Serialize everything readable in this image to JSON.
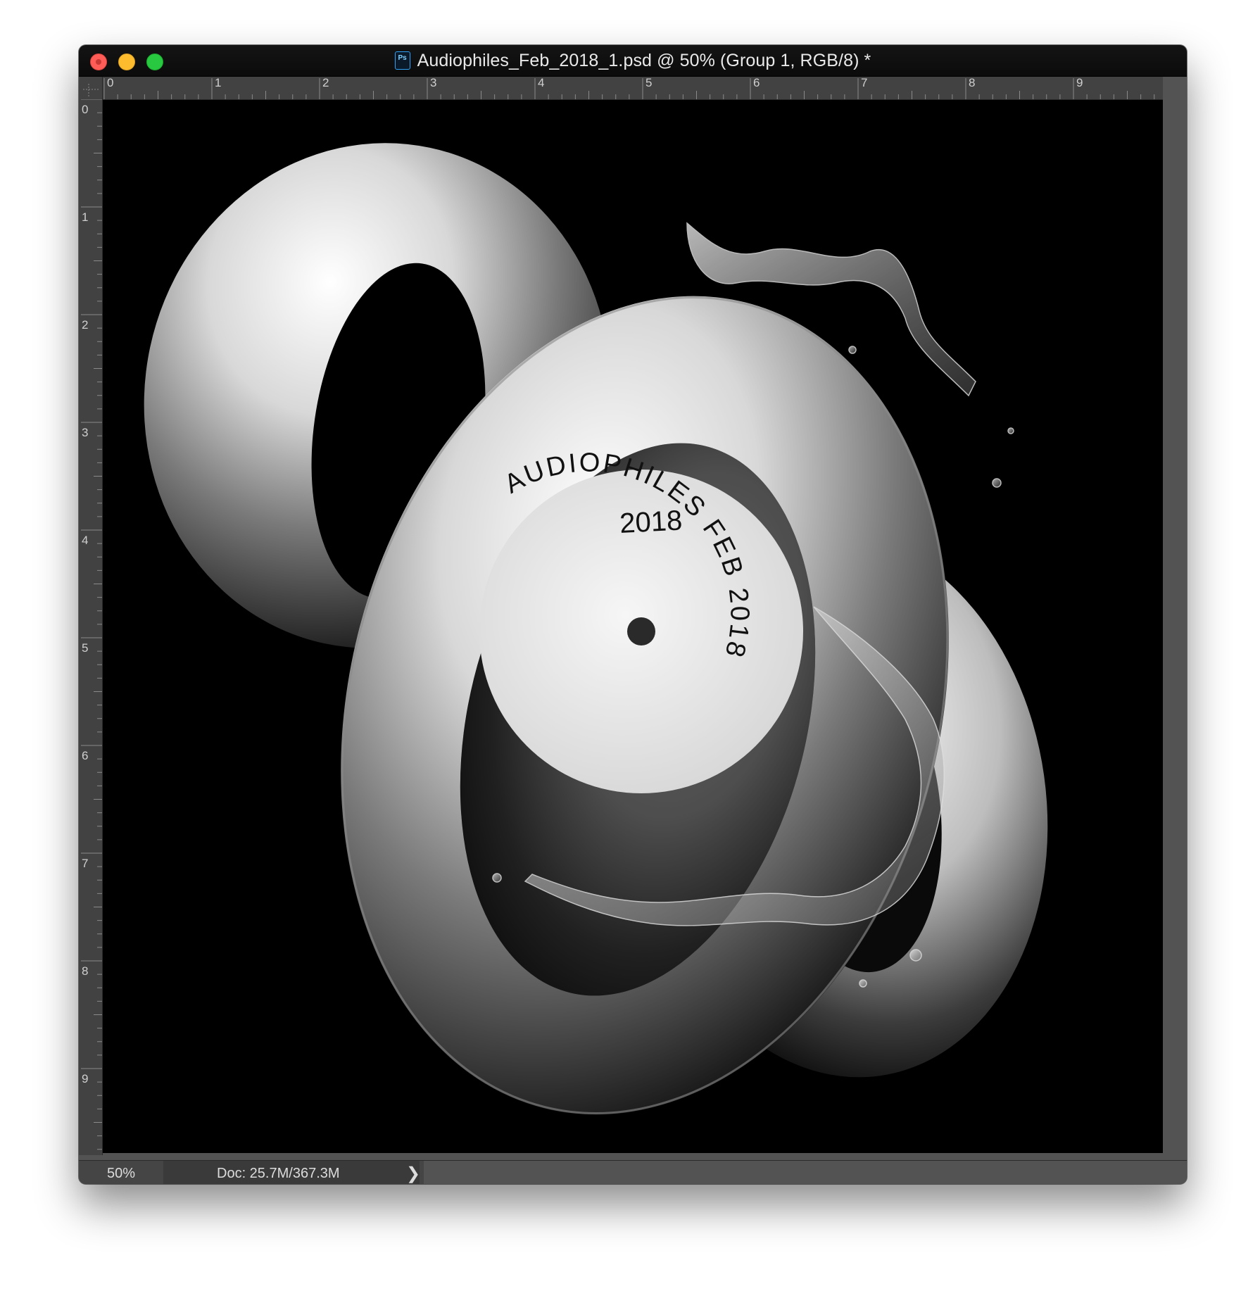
{
  "window": {
    "title": "Audiophiles_Feb_2018_1.psd @ 50% (Group 1, RGB/8) *",
    "app_icon": "photoshop-psd-icon",
    "app_icon_text": "Ps"
  },
  "rulers": {
    "top_labels": [
      "0",
      "1",
      "2",
      "3",
      "4",
      "5",
      "6",
      "7",
      "8",
      "9"
    ],
    "left_labels": [
      "0",
      "1",
      "2",
      "3",
      "4",
      "5",
      "6",
      "7",
      "8",
      "9"
    ]
  },
  "artwork": {
    "label_top": "2018",
    "label_arc": "AUDIOPHILES FEB 2018"
  },
  "status": {
    "zoom": "50%",
    "doc": "Doc: 25.7M/367.3M",
    "arrow": "❯"
  },
  "colors": {
    "titlebar": "#0b0b0b",
    "workspace": "#535353",
    "canvas": "#000000",
    "close": "#fd5c57",
    "minimize": "#fdbc2e",
    "maximize": "#28c840"
  }
}
